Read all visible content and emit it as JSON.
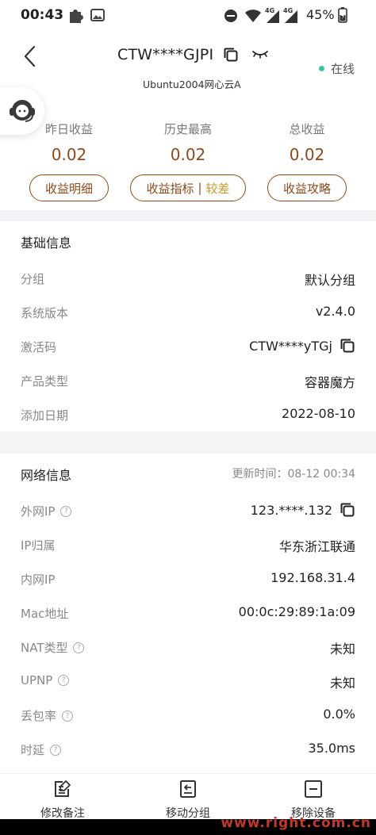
{
  "status_bar": {
    "time": "00:43",
    "network_1": "4G",
    "network_2": "4G",
    "battery": "45%"
  },
  "header": {
    "device_id": "CTW****GJPI",
    "subtitle": "Ubuntu2004网心云A",
    "status": "在线",
    "status_color": "#36c5a8"
  },
  "stats": [
    {
      "label": "昨日收益",
      "value": "0.02"
    },
    {
      "label": "历史最高",
      "value": "0.02"
    },
    {
      "label": "总收益",
      "value": "0.02"
    }
  ],
  "actions": {
    "earnings_detail": "收益明细",
    "earnings_index": "收益指标",
    "earnings_index_sep": "|",
    "earnings_index_badge": "较差",
    "earnings_guide": "收益攻略"
  },
  "basic": {
    "title": "基础信息",
    "rows": [
      {
        "label": "分组",
        "value": "默认分组"
      },
      {
        "label": "系统版本",
        "value": "v2.4.0"
      },
      {
        "label": "激活码",
        "value": "CTW****yTGj"
      },
      {
        "label": "产品类型",
        "value": "容器魔方"
      },
      {
        "label": "添加日期",
        "value": "2022-08-10"
      }
    ]
  },
  "network": {
    "title": "网络信息",
    "updated": "更新时间：08-12 00:34",
    "rows": [
      {
        "label": "外网IP",
        "value": "123.****.132"
      },
      {
        "label": "IP归属",
        "value": "华东浙江联通"
      },
      {
        "label": "内网IP",
        "value": "192.168.31.4"
      },
      {
        "label": "Mac地址",
        "value": "00:0c:29:89:1a:09"
      },
      {
        "label": "NAT类型",
        "value": "未知"
      },
      {
        "label": "UPNP",
        "value": "未知"
      },
      {
        "label": "丢包率",
        "value": "0.0%"
      },
      {
        "label": "时延",
        "value": "35.0ms"
      }
    ]
  },
  "bottom_bar": {
    "edit_note": "修改备注",
    "move_group": "移动分组",
    "remove_device": "移除设备"
  },
  "watermark": "www.right.com.cn",
  "colors": {
    "accent": "#8b4a1e",
    "badge": "#c69a2e",
    "online": "#36c5a8"
  }
}
